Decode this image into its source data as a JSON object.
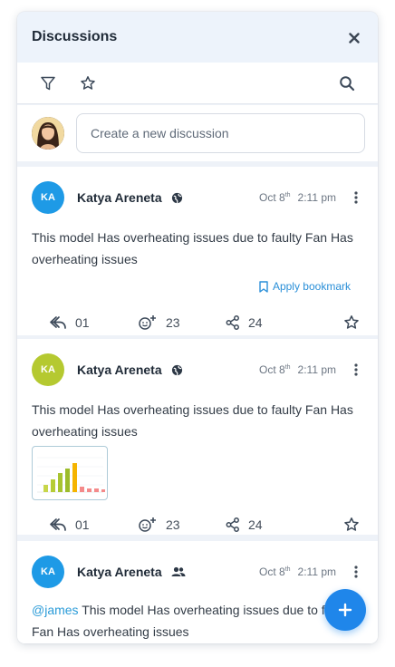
{
  "header": {
    "title": "Discussions"
  },
  "composer": {
    "placeholder": "Create a new discussion"
  },
  "posts": [
    {
      "initials": "KA",
      "avatar_color": "#1e9ae6",
      "author": "Katya Areneta",
      "visibility_icon": "globe-icon",
      "date_day": "Oct 8",
      "date_suffix": "th",
      "time": "2:11 pm",
      "text": "This model Has overheating issues due to faulty Fan Has overheating issues",
      "bookmark_label": "Apply bookmark",
      "replies": "01",
      "reactions": "23",
      "shares": "24"
    },
    {
      "initials": "KA",
      "avatar_color": "#b5c930",
      "author": "Katya Areneta",
      "visibility_icon": "globe-icon",
      "date_day": "Oct 8",
      "date_suffix": "th",
      "time": "2:11 pm",
      "text": "This model Has overheating issues due to faulty Fan Has overheating issues",
      "replies": "01",
      "reactions": "23",
      "shares": "24"
    },
    {
      "initials": "KA",
      "avatar_color": "#1e9ae6",
      "author": "Katya Areneta",
      "visibility_icon": "group-icon",
      "date_day": "Oct 8",
      "date_suffix": "th",
      "time": "2:11 pm",
      "mention": "@james",
      "text": " This model Has overheating issues due to faulty Fan Has overheating issues"
    }
  ],
  "colors": {
    "accent": "#1f86ea",
    "link": "#2a8fd8"
  }
}
